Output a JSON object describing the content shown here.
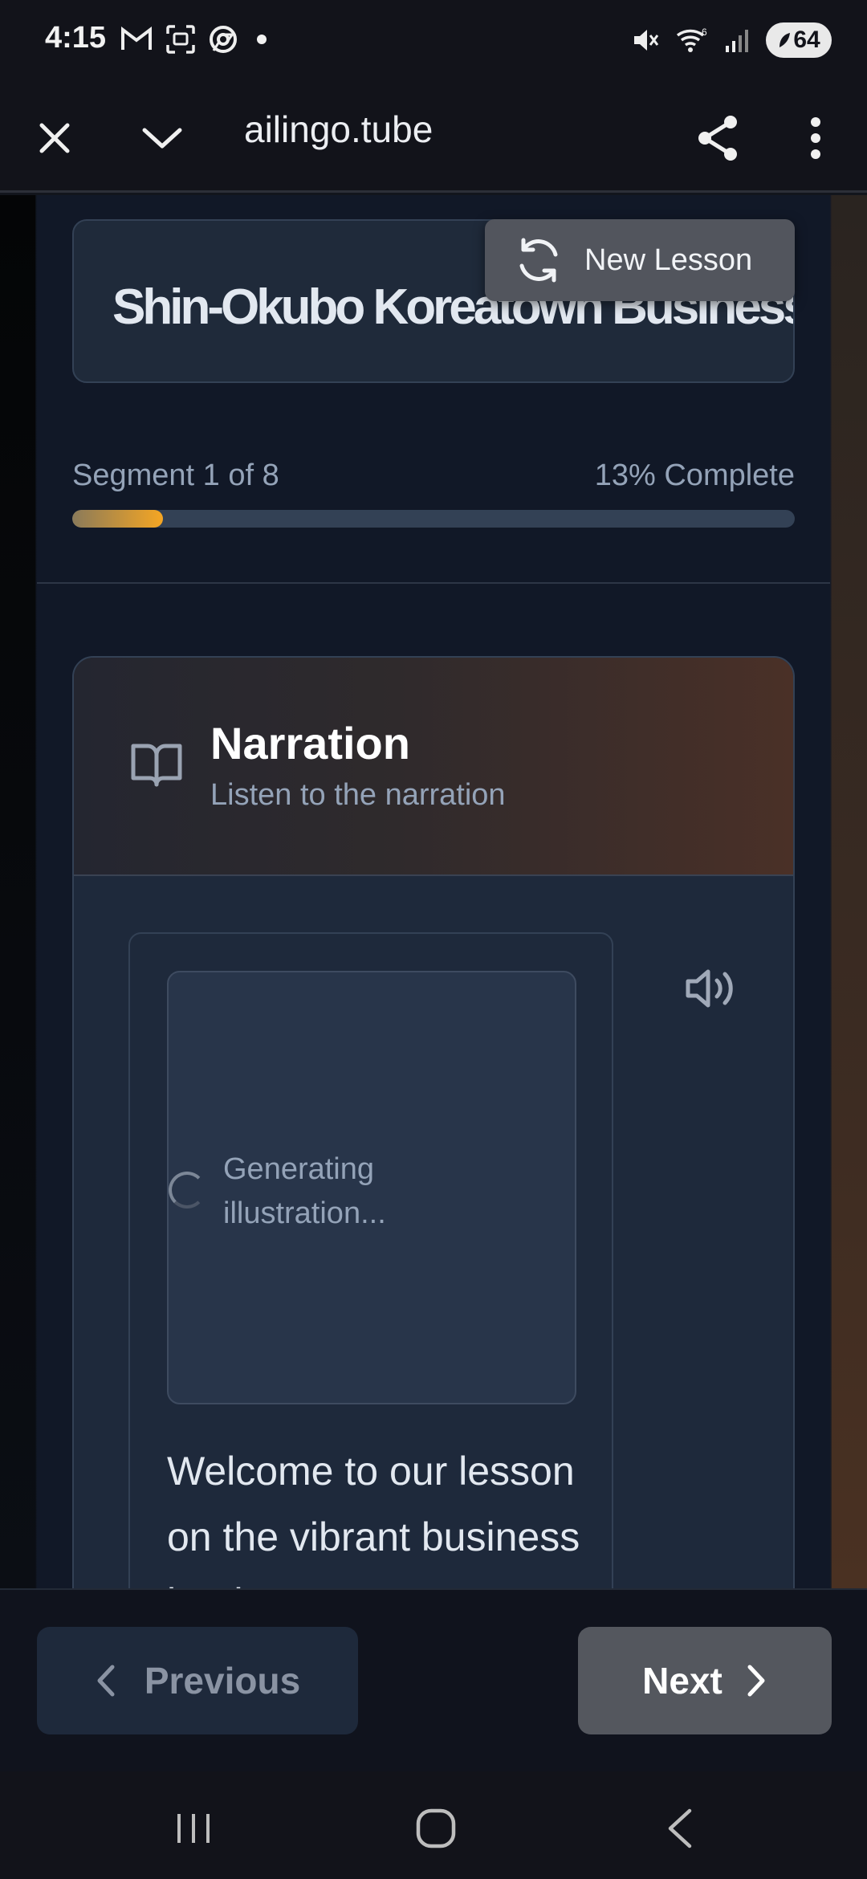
{
  "status_bar": {
    "time": "4:15",
    "battery": "64",
    "icons": [
      "gmail-icon",
      "screenshot-icon",
      "chrome-icon",
      "notification-dot",
      "mute-icon",
      "wifi-icon",
      "signal-icon",
      "battery-icon"
    ]
  },
  "browser": {
    "url": "ailingo.tube",
    "icons": [
      "close-icon",
      "chevron-down-icon",
      "share-icon",
      "more-vert-icon"
    ]
  },
  "lesson": {
    "title": "Shin-Okubo Koreatown Business",
    "new_lesson_label": "New Lesson",
    "segment_label": "Segment 1 of 8",
    "progress_label": "13% Complete",
    "progress_fraction": 0.125
  },
  "narration": {
    "title": "Narration",
    "subtitle": "Listen to the narration",
    "generating_text": "Generating illustration...",
    "body_text": "Welcome to our lesson on the vibrant business landscape"
  },
  "navigation": {
    "previous_label": "Previous",
    "next_label": "Next"
  },
  "colors": {
    "accent": "#f5a623",
    "background": "#111827",
    "card": "#1e293b"
  }
}
